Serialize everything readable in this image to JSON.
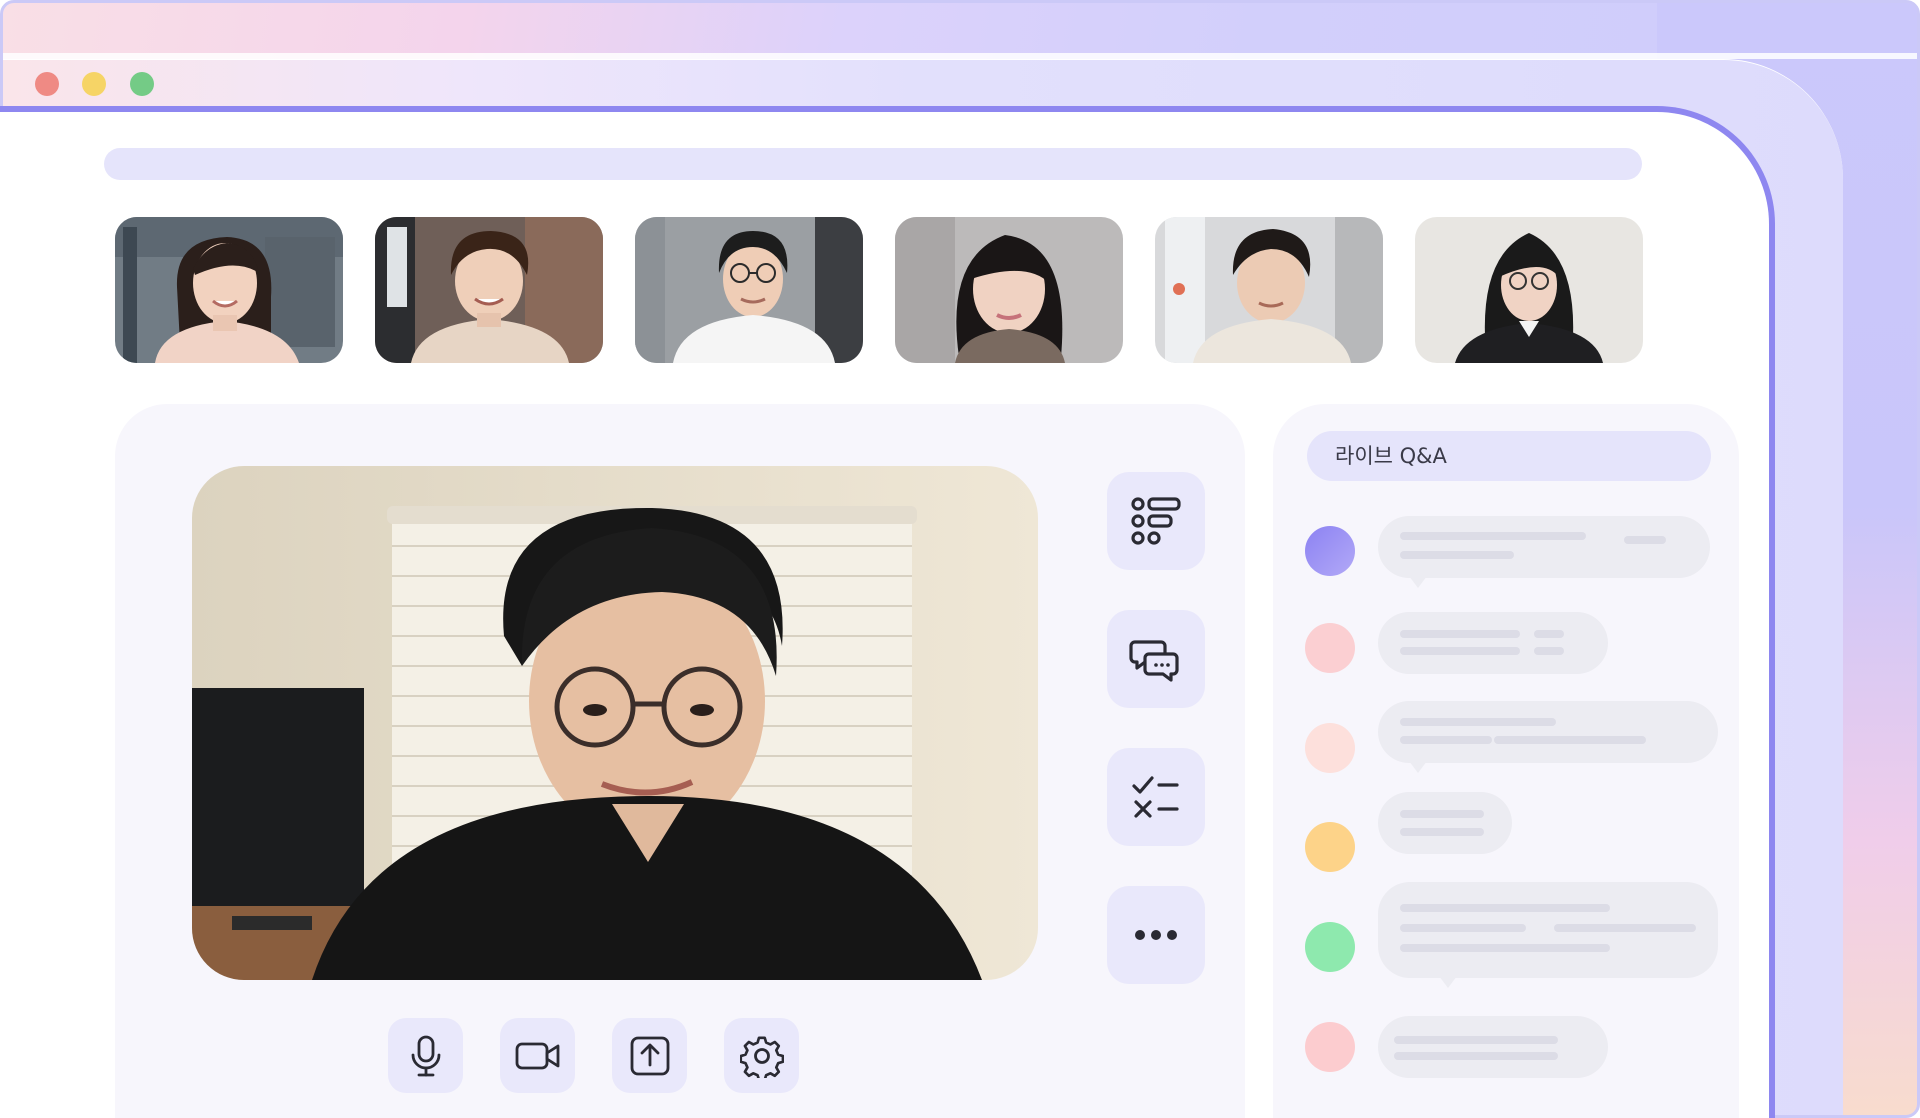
{
  "window": {
    "traffic_lights": [
      "close",
      "minimize",
      "maximize"
    ]
  },
  "participants": [
    {
      "name": "participant-1",
      "shirt": "#f1d3c6",
      "hair": "#2b1f1b",
      "bg": "#6d7780"
    },
    {
      "name": "participant-2",
      "shirt": "#e7d5c5",
      "hair": "#3a2418",
      "bg": "#7f6e66"
    },
    {
      "name": "participant-3",
      "shirt": "#f5f5f5",
      "hair": "#1d1d1d",
      "bg": "#8b8f93"
    },
    {
      "name": "participant-4",
      "shirt": "#7a6a60",
      "hair": "#1a1616",
      "bg": "#b6b4b4"
    },
    {
      "name": "participant-5",
      "shirt": "#ece6dd",
      "hair": "#1f1a18",
      "bg": "#d7d8da"
    },
    {
      "name": "participant-6",
      "shirt": "#1f1f22",
      "hair": "#1a1a1a",
      "bg": "#e8e6e2"
    }
  ],
  "side_tools": [
    {
      "icon": "agenda-list-icon"
    },
    {
      "icon": "chat-bubbles-icon"
    },
    {
      "icon": "poll-checklist-icon"
    },
    {
      "icon": "more-icon"
    }
  ],
  "controls": [
    {
      "icon": "microphone-icon"
    },
    {
      "icon": "camera-icon"
    },
    {
      "icon": "share-screen-icon"
    },
    {
      "icon": "settings-icon"
    }
  ],
  "qa": {
    "title": "라이브 Q&A",
    "messages": [
      {
        "avatar_color": "#9a90f4"
      },
      {
        "avatar_color": "#fbcfd2"
      },
      {
        "avatar_color": "#fde0dc"
      },
      {
        "avatar_color": "#fdd389"
      },
      {
        "avatar_color": "#8ee9ae"
      },
      {
        "avatar_color": "#fccccf"
      }
    ]
  },
  "colors": {
    "accent": "#8e87f0",
    "button_bg": "#e9e8fb",
    "panel_bg": "#f7f6fc",
    "icon_stroke": "#2a2a33"
  }
}
